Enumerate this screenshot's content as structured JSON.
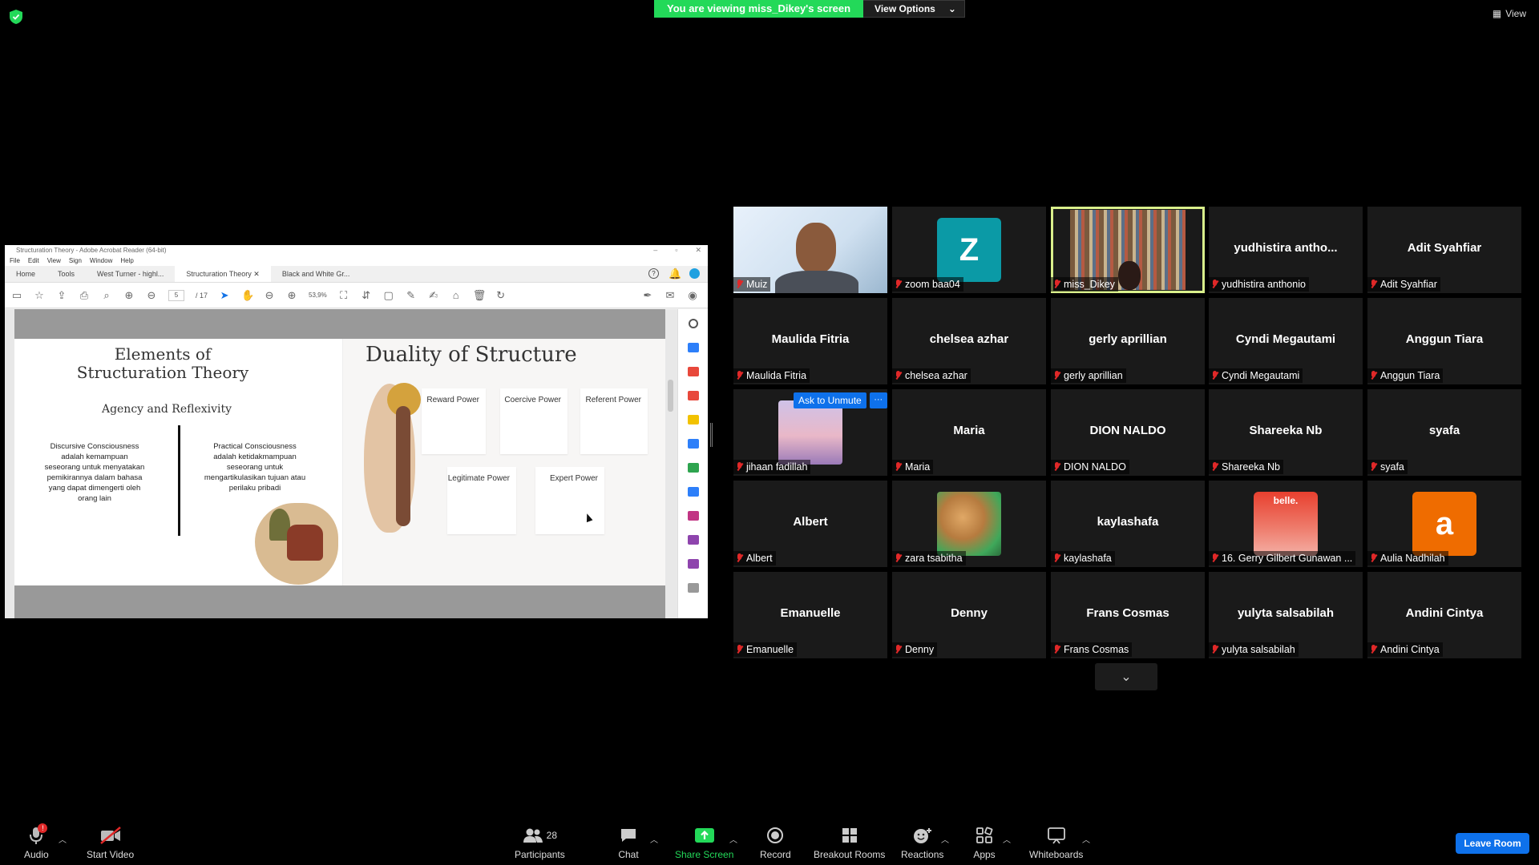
{
  "banner": {
    "viewing": "You are viewing miss_Dikey's screen",
    "view_options": "View Options",
    "view": "View"
  },
  "acrobat": {
    "title": "Structuration Theory - Adobe Acrobat Reader (64-bit)",
    "menu": [
      "File",
      "Edit",
      "View",
      "Sign",
      "Window",
      "Help"
    ],
    "tabs": [
      "Home",
      "Tools",
      "West Turner - highl...",
      "Structuration Theory",
      "Black and White Gr..."
    ],
    "page_current": "5",
    "page_total": "/ 17",
    "zoom": "53,9%"
  },
  "slide": {
    "left_title": "Elements of Structuration Theory",
    "left_subtitle": "Agency and Reflexivity",
    "discursive": "Discursive Consciousness adalah kemampuan seseorang untuk menyatakan pemikirannya dalam bahasa yang dapat dimengerti oleh orang lain",
    "practical": "Practical Consciousness adalah ketidakmampuan seseorang untuk mengartikulasikan tujuan atau perilaku pribadi",
    "right_title": "Duality of Structure",
    "cards": {
      "reward": "Reward Power",
      "coercive": "Coercive Power",
      "referent": "Referent Power",
      "legitimate": "Legitimate Power",
      "expert": "Expert Power"
    }
  },
  "gallery": {
    "tiles": [
      {
        "label": "Muiz",
        "center": ""
      },
      {
        "label": "zoom baa04",
        "center": "",
        "avatar_letter": "Z",
        "avatar_color": "#0b9aa6"
      },
      {
        "label": "miss_Dikey",
        "center": ""
      },
      {
        "label": "yudhistira anthonio",
        "center": "yudhistira antho..."
      },
      {
        "label": "Adit Syahfiar",
        "center": "Adit Syahfiar"
      },
      {
        "label": "Maulida Fitria",
        "center": "Maulida Fitria"
      },
      {
        "label": "chelsea azhar",
        "center": "chelsea azhar"
      },
      {
        "label": "gerly aprillian",
        "center": "gerly aprillian"
      },
      {
        "label": "Cyndi Megautami",
        "center": "Cyndi Megautami"
      },
      {
        "label": "Anggun Tiara",
        "center": "Anggun Tiara"
      },
      {
        "label": "jihaan fadillah",
        "center": ""
      },
      {
        "label": "Maria",
        "center": "Maria"
      },
      {
        "label": "DION NALDO",
        "center": "DION NALDO"
      },
      {
        "label": "Shareeka Nb",
        "center": "Shareeka Nb"
      },
      {
        "label": "syafa",
        "center": "syafa"
      },
      {
        "label": "Albert",
        "center": "Albert"
      },
      {
        "label": "zara tsabitha",
        "center": ""
      },
      {
        "label": "kaylashafa",
        "center": "kaylashafa"
      },
      {
        "label": "16. Gerry Gilbert Gunawan ...",
        "center": "",
        "avatar_text": "belle."
      },
      {
        "label": "Aulia Nadhilah",
        "center": "",
        "avatar_letter": "a",
        "avatar_color": "#ef6c00"
      },
      {
        "label": "Emanuelle",
        "center": "Emanuelle"
      },
      {
        "label": "Denny",
        "center": "Denny"
      },
      {
        "label": "Frans Cosmas",
        "center": "Frans Cosmas"
      },
      {
        "label": "yulyta salsabilah",
        "center": "yulyta salsabilah"
      },
      {
        "label": "Andini Cintya",
        "center": "Andini Cintya"
      }
    ],
    "ask_unmute": "Ask to Unmute",
    "more": "···"
  },
  "toolbar": {
    "audio": "Audio",
    "start_video": "Start Video",
    "participants": "Participants",
    "participants_count": "28",
    "chat": "Chat",
    "share_screen": "Share Screen",
    "record": "Record",
    "breakout_rooms": "Breakout Rooms",
    "reactions": "Reactions",
    "apps": "Apps",
    "whiteboards": "Whiteboards",
    "leave_room": "Leave Room",
    "audio_badge": "!"
  },
  "colors": {
    "accent_green": "#23d959",
    "zoom_blue": "#0e71eb",
    "active_speaker": "#d9ef8b",
    "muted_red": "#e02828"
  }
}
